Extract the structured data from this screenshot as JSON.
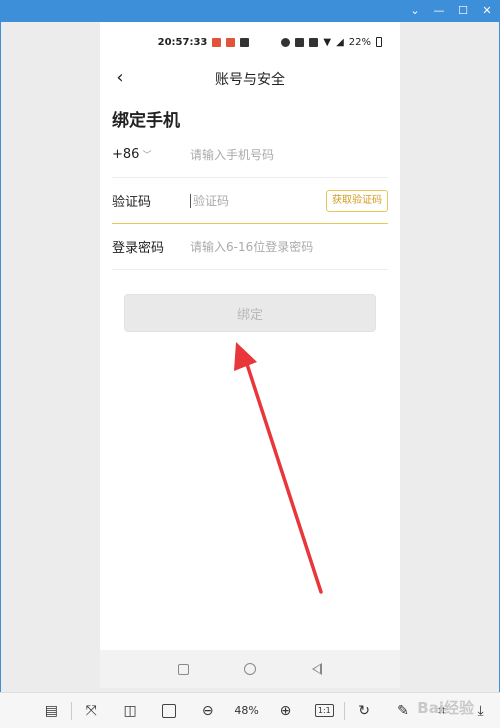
{
  "status_bar": {
    "time": "20:57:33",
    "battery": "22%"
  },
  "header": {
    "title": "账号与安全",
    "back_icon": "chevron-left-icon"
  },
  "section": {
    "title": "绑定手机"
  },
  "form": {
    "phone": {
      "country_code": "+86",
      "placeholder": "请输入手机号码"
    },
    "code": {
      "label": "验证码",
      "placeholder": "验证码",
      "button_label": "获取验证码"
    },
    "password": {
      "label": "登录密码",
      "placeholder": "请输入6-16位登录密码"
    }
  },
  "bind_button": {
    "label": "绑定"
  },
  "toolbar": {
    "zoom": "48%",
    "one_to_one": "1:1"
  },
  "watermark": "Bai经验",
  "colors": {
    "accent": "#e6c75a",
    "button_text": "#d49a1a",
    "arrow": "#e8363a",
    "window_frame": "#3c8fd8"
  }
}
